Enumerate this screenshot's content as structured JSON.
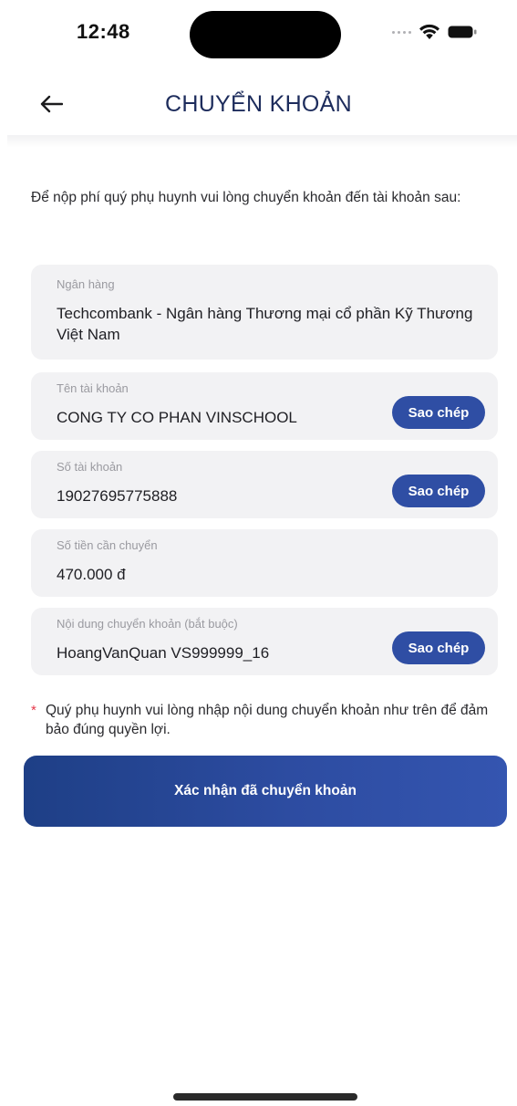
{
  "status_bar": {
    "time": "12:48"
  },
  "header": {
    "title": "CHUYỂN KHOẢN"
  },
  "intro": "Để nộp phí quý phụ huynh vui lòng chuyển khoản đến tài khoản sau:",
  "cards": {
    "bank": {
      "label": "Ngân hàng",
      "value": "Techcombank - Ngân hàng Thương mại cổ phần Kỹ Thương Việt Nam"
    },
    "account_name": {
      "label": "Tên tài khoản",
      "value": "CONG TY CO PHAN VINSCHOOL",
      "copy_label": "Sao chép"
    },
    "account_number": {
      "label": "Số tài khoản",
      "value": "19027695775888",
      "copy_label": "Sao chép"
    },
    "amount": {
      "label": "Số tiền cần chuyển",
      "value": "470.000 đ"
    },
    "transfer_content": {
      "label": "Nội dung chuyển khoản (bắt buộc)",
      "value": "HoangVanQuan VS999999_16",
      "copy_label": "Sao chép"
    }
  },
  "note": {
    "asterisk": "*",
    "text": "Quý phụ huynh vui lòng nhập nội dung chuyển khoản như trên để đảm bảo đúng quyền lợi."
  },
  "confirm_button": {
    "label": "Xác nhận đã chuyển khoản"
  },
  "colors": {
    "primary": "#2f4ea4",
    "title": "#1d2c5c",
    "card_bg": "#f2f2f4",
    "asterisk": "#e5384a"
  },
  "icons": {
    "back": "arrow-left-icon",
    "wifi": "wifi-icon",
    "battery": "battery-icon"
  }
}
